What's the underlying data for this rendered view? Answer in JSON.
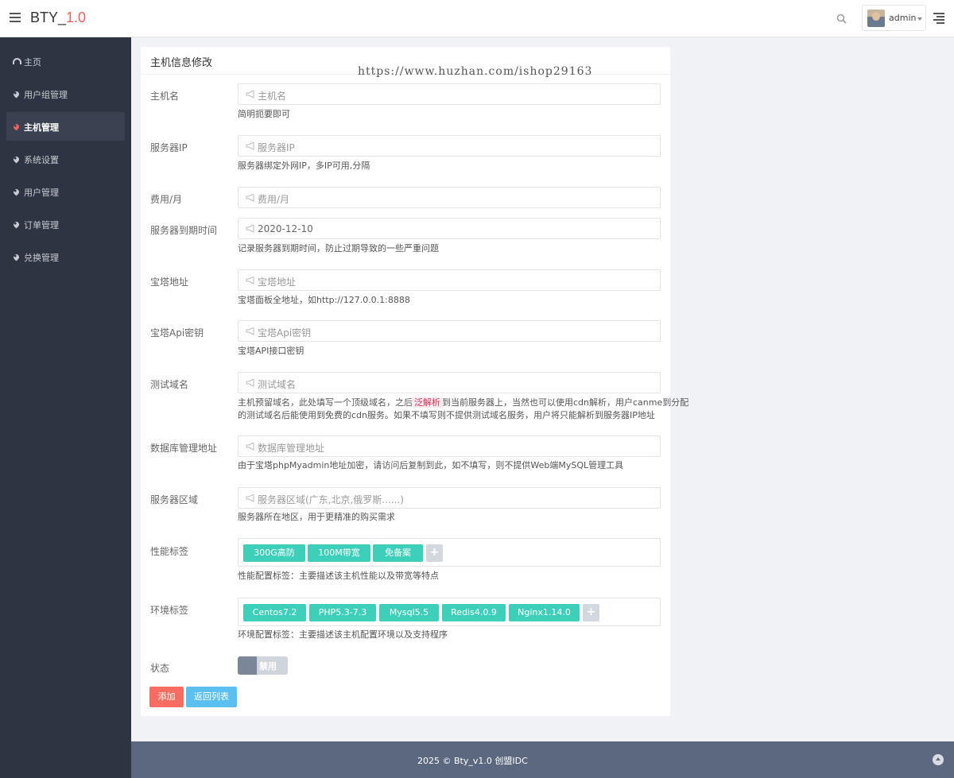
{
  "app": {
    "brand": "BTY_",
    "version": "1.0"
  },
  "header": {
    "user": "admin"
  },
  "sidebar": {
    "items": [
      {
        "label": "主页",
        "icon": "dashboard-icon"
      },
      {
        "label": "用户组管理",
        "icon": "map-marker-icon"
      },
      {
        "label": "主机管理",
        "icon": "map-marker-icon",
        "active": true
      },
      {
        "label": "系统设置",
        "icon": "map-marker-icon"
      },
      {
        "label": "用户管理",
        "icon": "map-marker-icon"
      },
      {
        "label": "订单管理",
        "icon": "map-marker-icon"
      },
      {
        "label": "兑换管理",
        "icon": "map-marker-icon"
      }
    ]
  },
  "panel": {
    "title": "主机信息修改"
  },
  "watermark": "https://www.huzhan.com/ishop29163",
  "form": {
    "hostname": {
      "label": "主机名",
      "placeholder": "主机名",
      "help": "简明扼要即可"
    },
    "server_ip": {
      "label": "服务器IP",
      "placeholder": "服务器IP",
      "help": "服务器绑定外网IP，多IP可用,分隔"
    },
    "cost": {
      "label": "费用/月",
      "placeholder": "费用/月"
    },
    "expire": {
      "label": "服务器到期时间",
      "value": "2020-12-10",
      "help": "记录服务器到期时间，防止过期导致的一些严重问题"
    },
    "bt_url": {
      "label": "宝塔地址",
      "placeholder": "宝塔地址",
      "help": "宝塔面板全地址，如http://127.0.0.1:8888"
    },
    "bt_key": {
      "label": "宝塔Api密钥",
      "placeholder": "宝塔Api密钥",
      "help": "宝塔API接口密钥"
    },
    "test_domain": {
      "label": "测试域名",
      "placeholder": "测试域名",
      "help_pre": "主机预留域名，此处填写一个顶级域名，之后",
      "help_highlight": "泛解析",
      "help_post": "到当前服务器上，当然也可以使用cdn解析，用户canme到分配",
      "help_line2": "的测试域名后能使用到免费的cdn服务。如果不填写则不提供测试域名服务，用户将只能解析到服务器IP地址"
    },
    "db_url": {
      "label": "数据库管理地址",
      "placeholder": "数据库管理地址",
      "help": "由于宝塔phpMyadmin地址加密，请访问后复制到此，如不填写，则不提供Web端MySQL管理工具"
    },
    "region": {
      "label": "服务器区域",
      "placeholder": "服务器区域(广东,北京,俄罗斯......)",
      "help": "服务器所在地区，用于更精准的购买需求"
    },
    "perf_tags": {
      "label": "性能标签",
      "tags": [
        "300G高防",
        "100M带宽",
        "免备案"
      ],
      "help": "性能配置标签：主要描述该主机性能以及带宽等特点"
    },
    "env_tags": {
      "label": "环境标签",
      "tags": [
        "Centos7.2",
        "PHP5.3-7.3",
        "Mysql5.5",
        "Redis4.0.9",
        "Nginx1.14.0"
      ],
      "help": "环境配置标签：主要描述该主机配置环境以及支持程序"
    },
    "status": {
      "label": "状态",
      "toggle_text": "禁用"
    },
    "add_label": "添加",
    "back_label": "返回列表",
    "add_tag_symbol": "+"
  },
  "footer": {
    "text": "2025 © Bty_v1.0 创盟IDC"
  },
  "colors": {
    "accent": "#3ecfbb",
    "danger": "#f86d62",
    "info": "#5bc0f0",
    "sidebar": "#2e3542",
    "footer": "#5b687f"
  }
}
